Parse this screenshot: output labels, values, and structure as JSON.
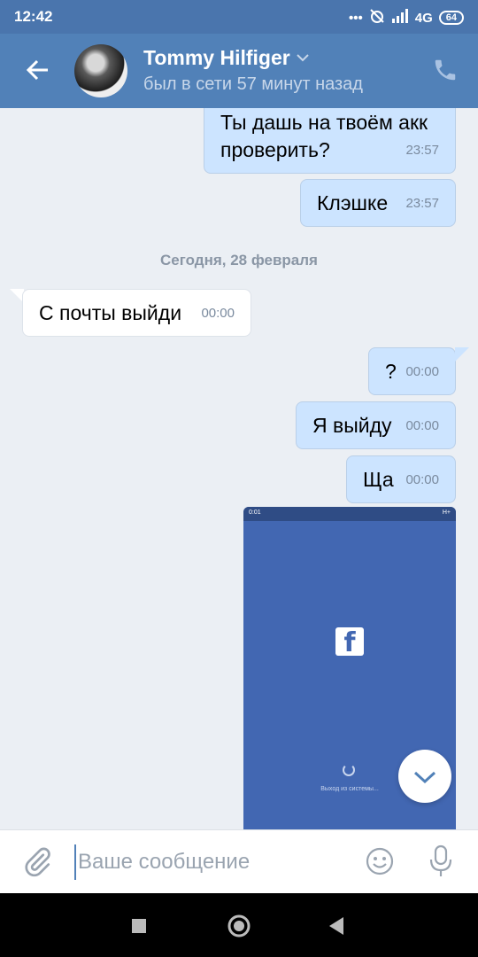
{
  "status_bar": {
    "time": "12:42",
    "network": "4G",
    "battery": "64"
  },
  "header": {
    "contact_name": "Tommy Hilfiger",
    "last_seen": "был в сети 57 минут назад"
  },
  "messages": [
    {
      "direction": "out",
      "text_line1": "Ты дашь на твоём акк",
      "text_line2": "проверить?",
      "time": "23:57"
    },
    {
      "direction": "out",
      "text": "Клэшке",
      "time": "23:57"
    },
    {
      "direction": "in",
      "text": "С почты выйди",
      "time": "00:00"
    },
    {
      "direction": "out",
      "text": "?",
      "time": "00:00"
    },
    {
      "direction": "out",
      "text": "Я выйду",
      "time": "00:00"
    },
    {
      "direction": "out",
      "text": "Ща",
      "time": "00:00"
    }
  ],
  "date_separator": "Сегодня, 28 февраля",
  "photo": {
    "status_time": "0:01",
    "status_right": "H+",
    "logo": "f",
    "loading_text": "Выход из системы..."
  },
  "composer": {
    "placeholder": "Ваше сообщение"
  },
  "colors": {
    "header": "#5181b8",
    "status_bar": "#4a75ad",
    "outgoing_bubble": "#cce4ff",
    "incoming_bubble": "#ffffff",
    "chat_background": "#ebeff4"
  },
  "icons": [
    "back-arrow-icon",
    "chevron-down-icon",
    "phone-icon",
    "paperclip-icon",
    "emoji-icon",
    "microphone-icon",
    "chevron-down-icon",
    "square-nav-icon",
    "circle-nav-icon",
    "triangle-back-nav-icon"
  ]
}
